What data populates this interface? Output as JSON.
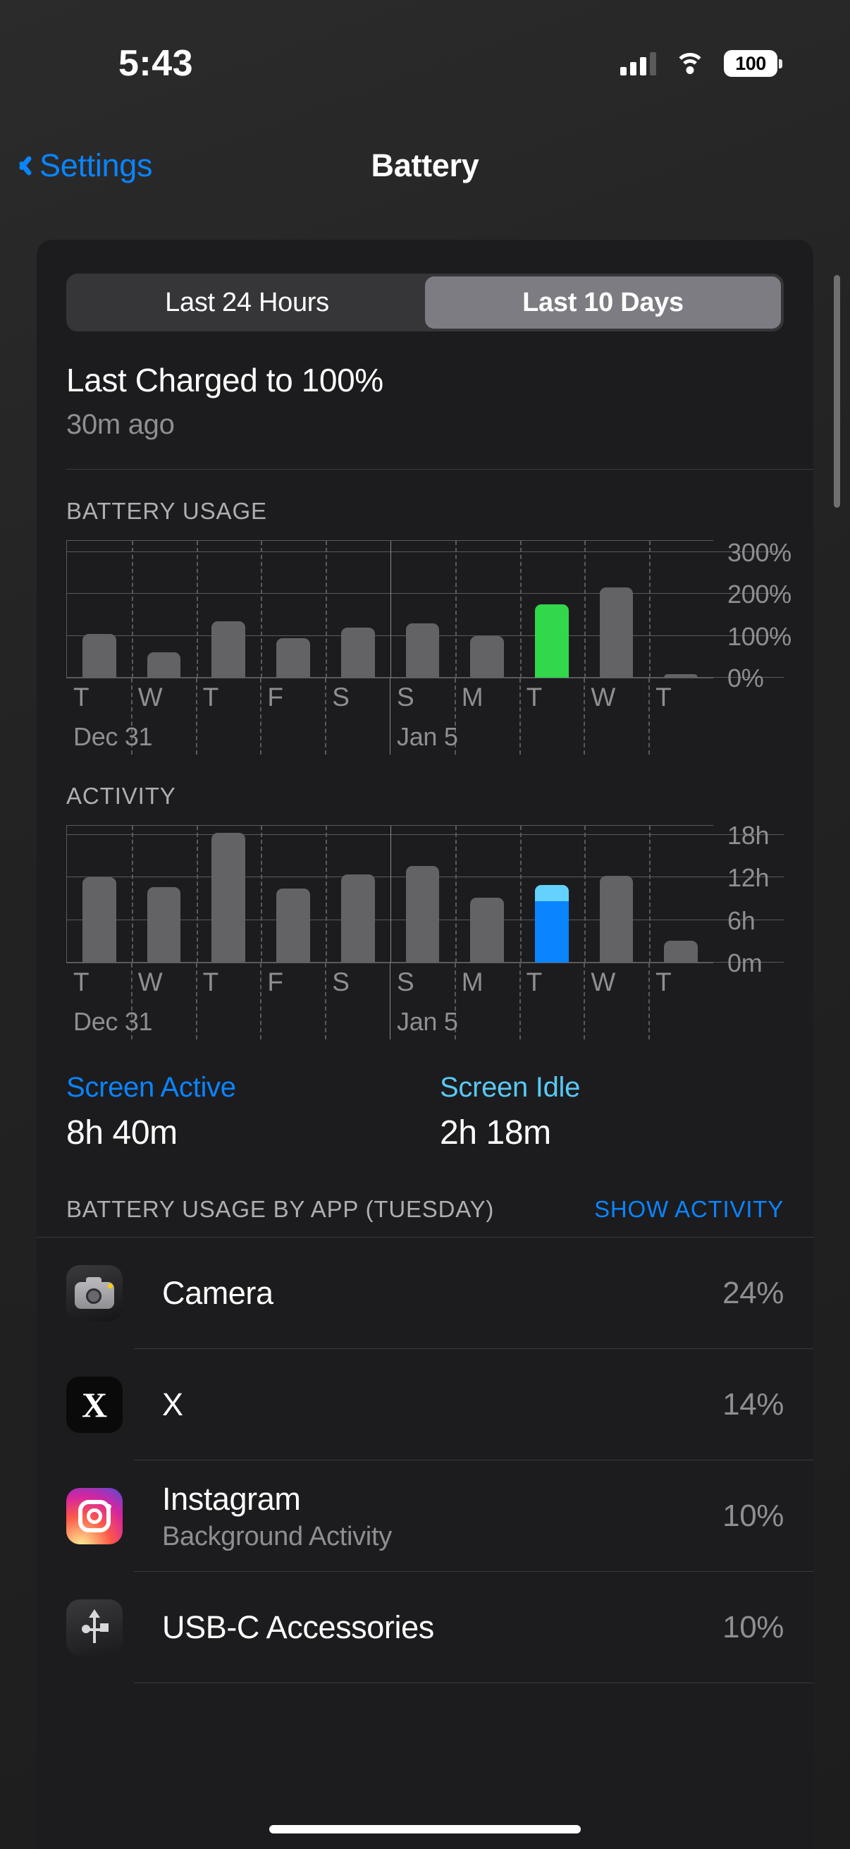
{
  "status_bar": {
    "time": "5:43",
    "battery_percent": "100",
    "cellular_icon": "cellular-signal-icon",
    "wifi_icon": "wifi-icon"
  },
  "nav": {
    "back_label": "Settings",
    "title": "Battery"
  },
  "segmented": {
    "options": [
      "Last 24 Hours",
      "Last 10 Days"
    ],
    "selected": "Last 10 Days"
  },
  "charged": {
    "title": "Last Charged to 100%",
    "subtitle": "30m ago"
  },
  "sections": {
    "battery_usage_label": "BATTERY USAGE",
    "activity_label": "ACTIVITY"
  },
  "screen_stats": {
    "active_label": "Screen Active",
    "active_value": "8h 40m",
    "idle_label": "Screen Idle",
    "idle_value": "2h 18m"
  },
  "app_section": {
    "header": "BATTERY USAGE BY APP (TUESDAY)",
    "action": "SHOW ACTIVITY",
    "rows": [
      {
        "icon": "camera-app-icon",
        "name": "Camera",
        "subtitle": "",
        "percent": "24%"
      },
      {
        "icon": "x-app-icon",
        "name": "X",
        "subtitle": "",
        "percent": "14%"
      },
      {
        "icon": "instagram-app-icon",
        "name": "Instagram",
        "subtitle": "Background Activity",
        "percent": "10%"
      },
      {
        "icon": "usb-c-accessories-icon",
        "name": "USB-C Accessories",
        "subtitle": "",
        "percent": "10%"
      }
    ]
  },
  "colors": {
    "accent_blue": "#0A84FF",
    "highlight_green": "#32D74B",
    "screen_active_blue": "#0A84FF",
    "screen_idle_cyan": "#64D2FF",
    "bar_gray": "#636366",
    "card_bg": "#1C1C1E"
  },
  "chart_data": [
    {
      "type": "bar",
      "title": "BATTERY USAGE",
      "xlabel": "",
      "ylabel": "%",
      "ylim": [
        0,
        330
      ],
      "yticks": [
        0,
        100,
        200,
        300
      ],
      "ytick_labels": [
        "0%",
        "100%",
        "200%",
        "300%"
      ],
      "grid": true,
      "categories": [
        "T",
        "W",
        "T",
        "F",
        "S",
        "S",
        "M",
        "T",
        "W",
        "T"
      ],
      "date_labels": [
        {
          "index": 0,
          "label": "Dec 31"
        },
        {
          "index": 5,
          "label": "Jan 5"
        }
      ],
      "values": [
        105,
        60,
        135,
        95,
        120,
        130,
        100,
        175,
        215,
        8
      ],
      "highlight_index": 7,
      "highlight_color": "#32D74B",
      "bar_color": "#636366"
    },
    {
      "type": "bar",
      "title": "ACTIVITY",
      "xlabel": "",
      "ylabel": "hours",
      "ylim": [
        0,
        19.5
      ],
      "yticks": [
        0,
        6,
        12,
        18
      ],
      "ytick_labels": [
        "0m",
        "6h",
        "12h",
        "18h"
      ],
      "grid": true,
      "categories": [
        "T",
        "W",
        "T",
        "F",
        "S",
        "S",
        "M",
        "T",
        "W",
        "T"
      ],
      "date_labels": [
        {
          "index": 0,
          "label": "Dec 31"
        },
        {
          "index": 5,
          "label": "Jan 5"
        }
      ],
      "values": [
        12.0,
        10.6,
        18.3,
        10.4,
        12.4,
        13.6,
        9.2,
        10.9,
        12.2,
        3.1
      ],
      "stacked_highlight": {
        "index": 7,
        "active": 8.66,
        "idle": 2.3,
        "active_color": "#0A84FF",
        "idle_color": "#64D2FF"
      },
      "bar_color": "#636366"
    }
  ]
}
